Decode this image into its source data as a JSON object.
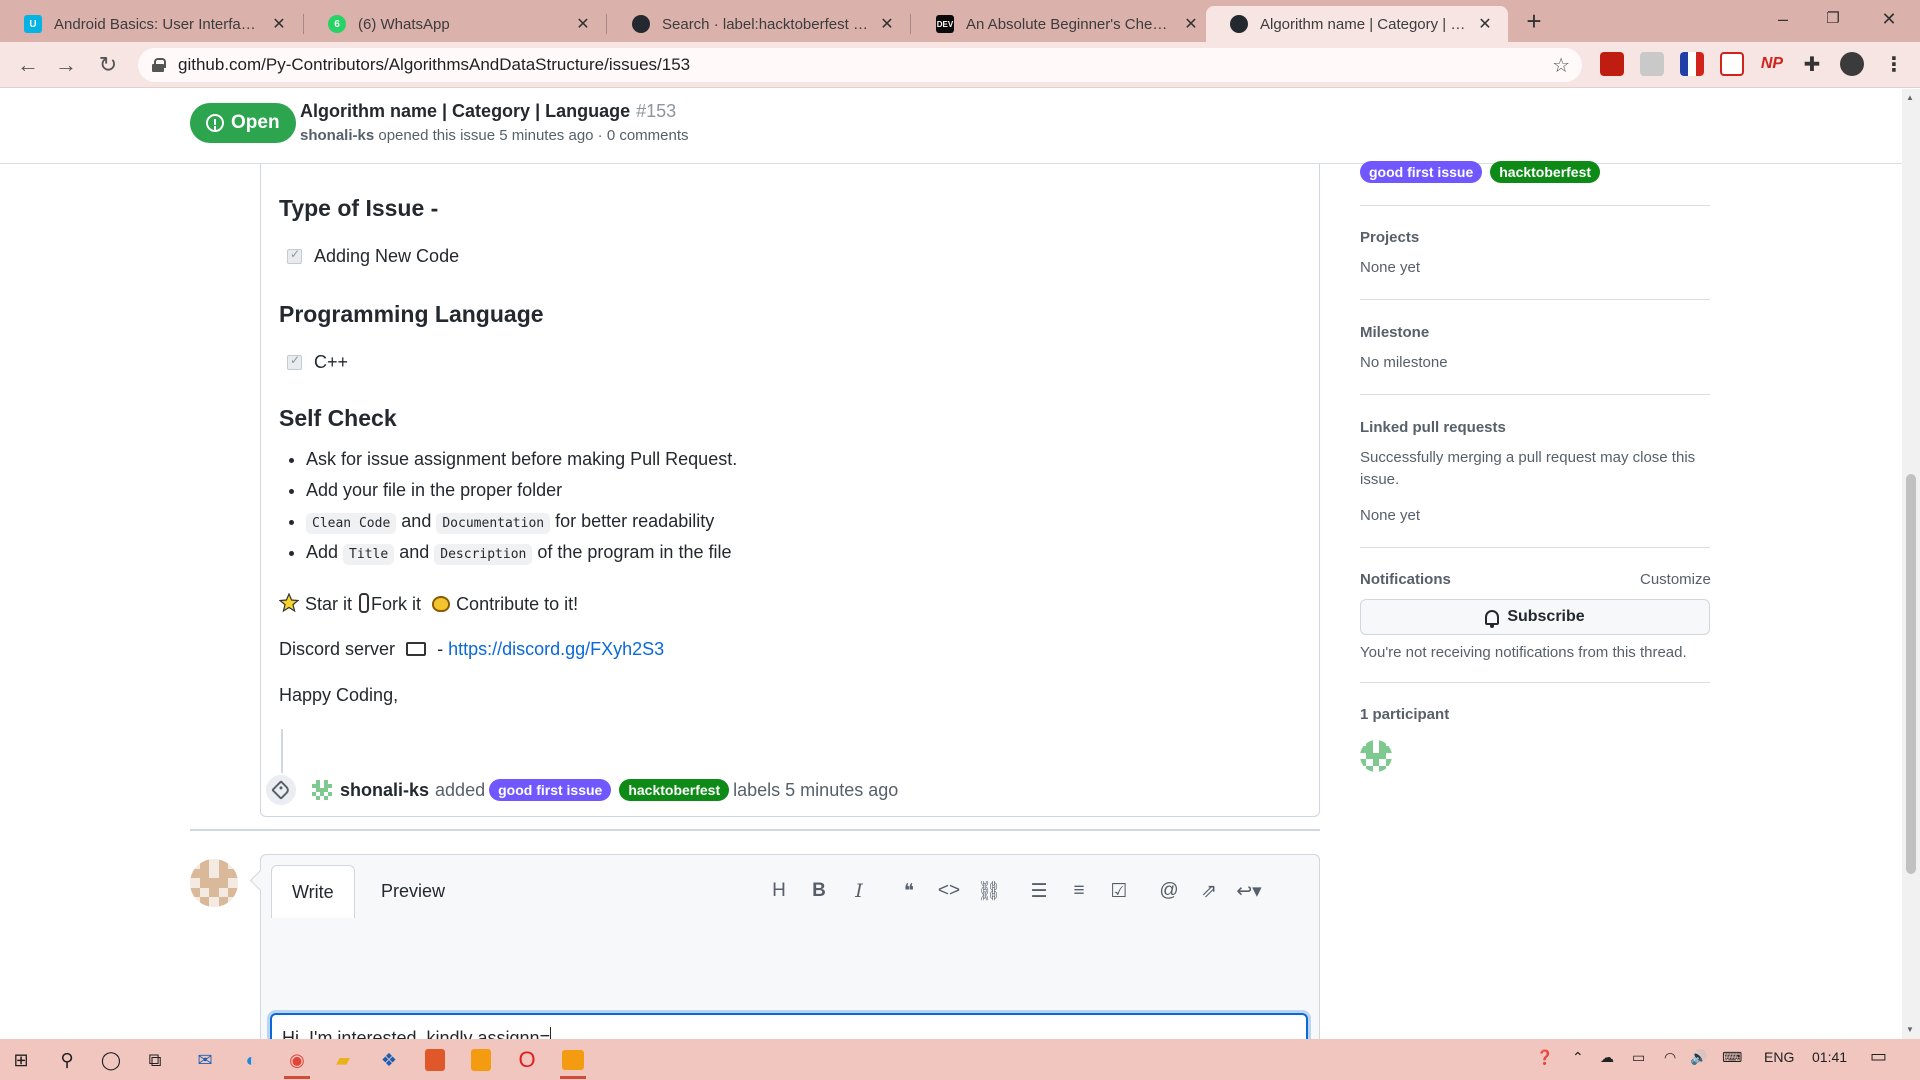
{
  "browser": {
    "tabs": [
      {
        "title": "Android Basics: User Interface - U",
        "favicon": "udacity-icon",
        "color": "#02b3e4",
        "active": false
      },
      {
        "title": "(6) WhatsApp",
        "favicon": "whatsapp-icon",
        "color": "#25d366",
        "badge": "6",
        "active": false
      },
      {
        "title": "Search · label:hacktoberfest state",
        "favicon": "github-icon",
        "color": "#24292f",
        "active": false
      },
      {
        "title": "An Absolute Beginner's Checklist",
        "favicon": "dev-icon",
        "color": "#0a0a0a",
        "badge": "DEV",
        "active": false
      },
      {
        "title": "Algorithm name | Category | Lang",
        "favicon": "github-icon",
        "color": "#24292f",
        "active": true
      }
    ],
    "url": "github.com/Py-Contributors/AlgorithmsAndDataStructure/issues/153"
  },
  "issue": {
    "state": "Open",
    "title": "Algorithm name | Category | Language",
    "number": "#153",
    "author": "shonali-ks",
    "meta_rest": "opened this issue 5 minutes ago · 0 comments"
  },
  "body": {
    "type_heading": "Type of Issue -",
    "type_item": "Adding New Code",
    "lang_heading": "Programming Language",
    "lang_item": "C++",
    "selfcheck_heading": "Self Check",
    "bullet1": "Ask for issue assignment before making Pull Request.",
    "bullet2": "Add your file in the proper folder",
    "b3_code1": "Clean Code",
    "b3_and": "and",
    "b3_code2": "Documentation",
    "b3_rest": "for better readability",
    "b4_add": "Add",
    "b4_code1": "Title",
    "b4_and": "and",
    "b4_code2": "Description",
    "b4_rest": "of the program in the file",
    "star_text": "Star it",
    "fork_text": "Fork it",
    "contribute_text": "Contribute to it!",
    "discord_label": "Discord server",
    "discord_dash": "-",
    "discord_link": "https://discord.gg/FXyh2S3",
    "closing": "Happy Coding,"
  },
  "timeline": {
    "actor": "shonali-ks",
    "verb": "added",
    "label1": "good first issue",
    "label2": "hacktoberfest",
    "suffix": "labels 5 minutes ago"
  },
  "composer": {
    "tab_write": "Write",
    "tab_preview": "Preview",
    "text_before": "Hi. I'm interested. kindly ",
    "text_misspelled": "assignn",
    "text_after": "="
  },
  "sidebar": {
    "label1": "good first issue",
    "label2": "hacktoberfest",
    "projects_heading": "Projects",
    "projects_value": "None yet",
    "milestone_heading": "Milestone",
    "milestone_value": "No milestone",
    "linked_heading": "Linked pull requests",
    "linked_desc": "Successfully merging a pull request may close this issue.",
    "linked_value": "None yet",
    "notif_heading": "Notifications",
    "notif_customize": "Customize",
    "subscribe_label": "Subscribe",
    "notif_desc": "You're not receiving notifications from this thread.",
    "participants_heading": "1 participant"
  },
  "taskbar": {
    "lang": "ENG",
    "time": "01:41"
  },
  "colors": {
    "open_green": "#2da44e",
    "label_good_first_issue": "#7057ff",
    "label_hacktoberfest": "#0e8a16",
    "link_blue": "#0969da"
  }
}
